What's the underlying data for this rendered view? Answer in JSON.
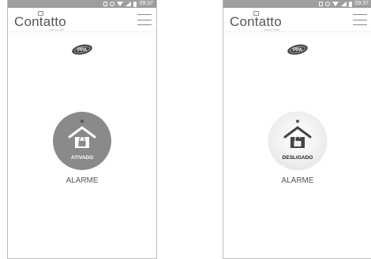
{
  "screens": [
    {
      "statusbar": {
        "time": "09:37"
      },
      "app": {
        "logo_text": "Contatto",
        "logo_sub": "Powered by EXP"
      },
      "alarm": {
        "state": "ATIVADO",
        "label": "ALARME"
      }
    },
    {
      "statusbar": {
        "time": "09:37"
      },
      "app": {
        "logo_text": "Contatto",
        "logo_sub": "Powered by EXP"
      },
      "alarm": {
        "state": "DESLIGADO",
        "label": "ALARME"
      }
    }
  ],
  "brand": {
    "logo_text": "PPA"
  },
  "colors": {
    "statusbar": "#9e9e9e",
    "armed": "#8a8a8a",
    "disarmed": "#f0f0f0"
  },
  "icons": {
    "menu": "hamburger-menu-icon",
    "alarm_on": "house-locked-icon",
    "alarm_off": "house-unlocked-icon"
  }
}
